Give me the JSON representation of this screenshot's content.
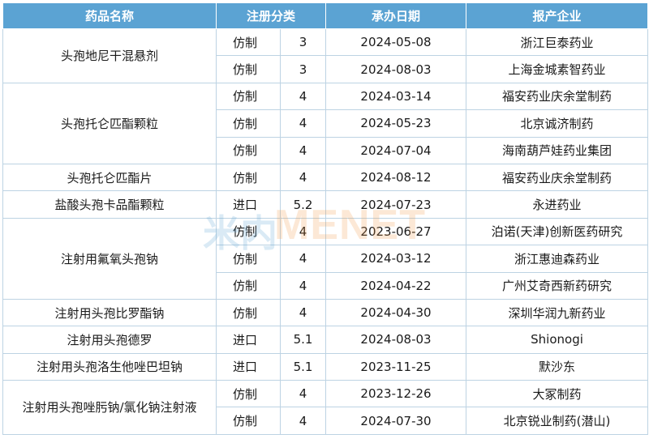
{
  "headers": {
    "drug_name": "药品名称",
    "reg_category": "注册分类",
    "date": "承办日期",
    "company": "报产企业"
  },
  "groups": [
    {
      "drug": "头孢地尼干混悬剂",
      "rows": [
        {
          "type": "仿制",
          "class": "3",
          "date": "2024-05-08",
          "company": "浙江巨泰药业"
        },
        {
          "type": "仿制",
          "class": "3",
          "date": "2024-08-03",
          "company": "上海金城素智药业"
        }
      ]
    },
    {
      "drug": "头孢托仑匹酯颗粒",
      "rows": [
        {
          "type": "仿制",
          "class": "4",
          "date": "2024-03-14",
          "company": "福安药业庆余堂制药"
        },
        {
          "type": "仿制",
          "class": "4",
          "date": "2024-05-23",
          "company": "北京诚济制药"
        },
        {
          "type": "仿制",
          "class": "4",
          "date": "2024-07-04",
          "company": "海南葫芦娃药业集团"
        }
      ]
    },
    {
      "drug": "头孢托仑匹酯片",
      "rows": [
        {
          "type": "仿制",
          "class": "4",
          "date": "2024-08-12",
          "company": "福安药业庆余堂制药"
        }
      ]
    },
    {
      "drug": "盐酸头孢卡品酯颗粒",
      "rows": [
        {
          "type": "进口",
          "class": "5.2",
          "date": "2024-07-23",
          "company": "永进药业"
        }
      ]
    },
    {
      "drug": "注射用氟氧头孢钠",
      "rows": [
        {
          "type": "仿制",
          "class": "4",
          "date": "2023-06-27",
          "company": "泊诺(天津)创新医药研究"
        },
        {
          "type": "仿制",
          "class": "4",
          "date": "2024-03-12",
          "company": "浙江惠迪森药业"
        },
        {
          "type": "仿制",
          "class": "4",
          "date": "2024-04-22",
          "company": "广州艾奇西新药研究"
        }
      ]
    },
    {
      "drug": "注射用头孢比罗酯钠",
      "rows": [
        {
          "type": "仿制",
          "class": "4",
          "date": "2024-04-30",
          "company": "深圳华润九新药业"
        }
      ]
    },
    {
      "drug": "注射用头孢德罗",
      "rows": [
        {
          "type": "进口",
          "class": "5.1",
          "date": "2024-08-03",
          "company": "Shionogi"
        }
      ]
    },
    {
      "drug": "注射用头孢洛生他唑巴坦钠",
      "rows": [
        {
          "type": "进口",
          "class": "5.1",
          "date": "2023-11-25",
          "company": "默沙东"
        }
      ]
    },
    {
      "drug": "注射用头孢唑肟钠/氯化钠注射液",
      "rows": [
        {
          "type": "仿制",
          "class": "4",
          "date": "2023-12-26",
          "company": "大冢制药"
        },
        {
          "type": "仿制",
          "class": "4",
          "date": "2024-07-30",
          "company": "北京锐业制药(潜山)"
        }
      ]
    }
  ],
  "watermark": {
    "cn": "米内",
    "en": "MENET"
  },
  "colors": {
    "header_bg": "#5ba3d3",
    "header_text": "#ffffff",
    "border": "#bdd3e3",
    "watermark_orange": "#f29a47"
  }
}
